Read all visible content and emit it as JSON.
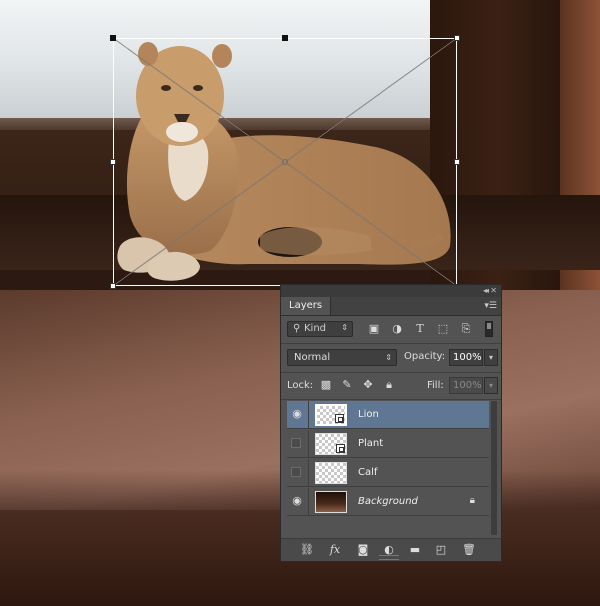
{
  "panel": {
    "tab_label": "Layers",
    "collapse_icon": "double-chevron-icon",
    "close_icon": "close-icon",
    "menu_icon": "panel-menu-icon"
  },
  "filter": {
    "kind_label": "Kind",
    "icons": [
      "pixel-filter-icon",
      "adjustment-filter-icon",
      "type-filter-icon",
      "shape-filter-icon",
      "smart-object-filter-icon"
    ]
  },
  "blend": {
    "mode": "Normal",
    "opacity_label": "Opacity:",
    "opacity_value": "100%"
  },
  "lock": {
    "label": "Lock:",
    "icons": [
      "lock-transparent-icon",
      "lock-image-icon",
      "lock-position-icon",
      "lock-all-icon"
    ],
    "fill_label": "Fill:",
    "fill_value": "100%"
  },
  "layers": [
    {
      "name": "Lion",
      "visible": true,
      "selected": true,
      "smart_object": true
    },
    {
      "name": "Plant",
      "visible": false,
      "selected": false,
      "smart_object": true
    },
    {
      "name": "Calf",
      "visible": false,
      "selected": false,
      "smart_object": false
    },
    {
      "name": "Background",
      "visible": true,
      "selected": false,
      "locked": true
    }
  ],
  "bottom_bar_icons": [
    "link-layers-icon",
    "fx-icon",
    "add-mask-icon",
    "adjustment-layer-icon",
    "new-group-icon",
    "new-layer-icon",
    "trash-icon"
  ],
  "fx_label": "fx"
}
